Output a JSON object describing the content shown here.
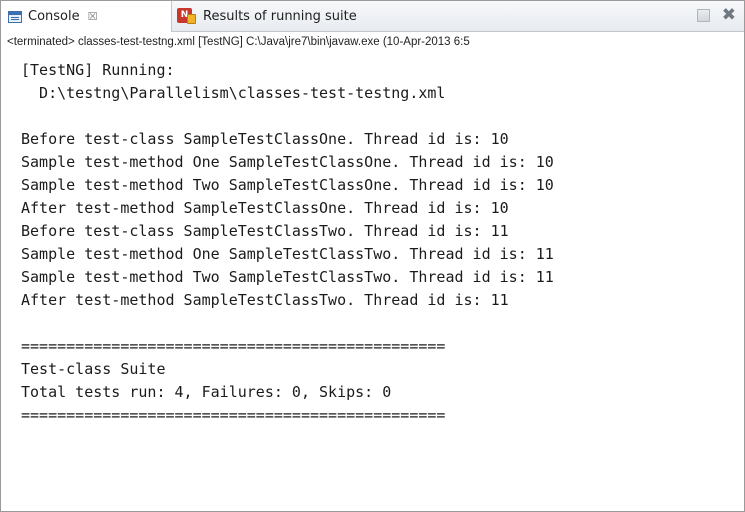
{
  "tabs": {
    "console_label": "Console",
    "console_close_glyph": "☒",
    "results_label": "Results of running suite"
  },
  "status": {
    "text": "<terminated> classes-test-testng.xml [TestNG] C:\\Java\\jre7\\bin\\javaw.exe (10-Apr-2013 6:5"
  },
  "console": {
    "lines": [
      "[TestNG] Running:",
      "  D:\\testng\\Parallelism\\classes-test-testng.xml",
      "",
      "Before test-class SampleTestClassOne. Thread id is: 10",
      "Sample test-method One SampleTestClassOne. Thread id is: 10",
      "Sample test-method Two SampleTestClassOne. Thread id is: 10",
      "After test-method SampleTestClassOne. Thread id is: 10",
      "Before test-class SampleTestClassTwo. Thread id is: 11",
      "Sample test-method One SampleTestClassTwo. Thread id is: 11",
      "Sample test-method Two SampleTestClassTwo. Thread id is: 11",
      "After test-method SampleTestClassTwo. Thread id is: 11",
      "",
      "===============================================",
      "Test-class Suite",
      "Total tests run: 4, Failures: 0, Skips: 0",
      "==============================================="
    ]
  },
  "icons": {
    "console": "console-icon",
    "results": "testng-icon",
    "minimize": "minimize-icon",
    "close": "close-icon"
  },
  "colors": {
    "tab_bar": "#e7ebf0",
    "text": "#1b1b1b",
    "testng_red": "#c8372d",
    "testng_yellow": "#f0b428"
  }
}
